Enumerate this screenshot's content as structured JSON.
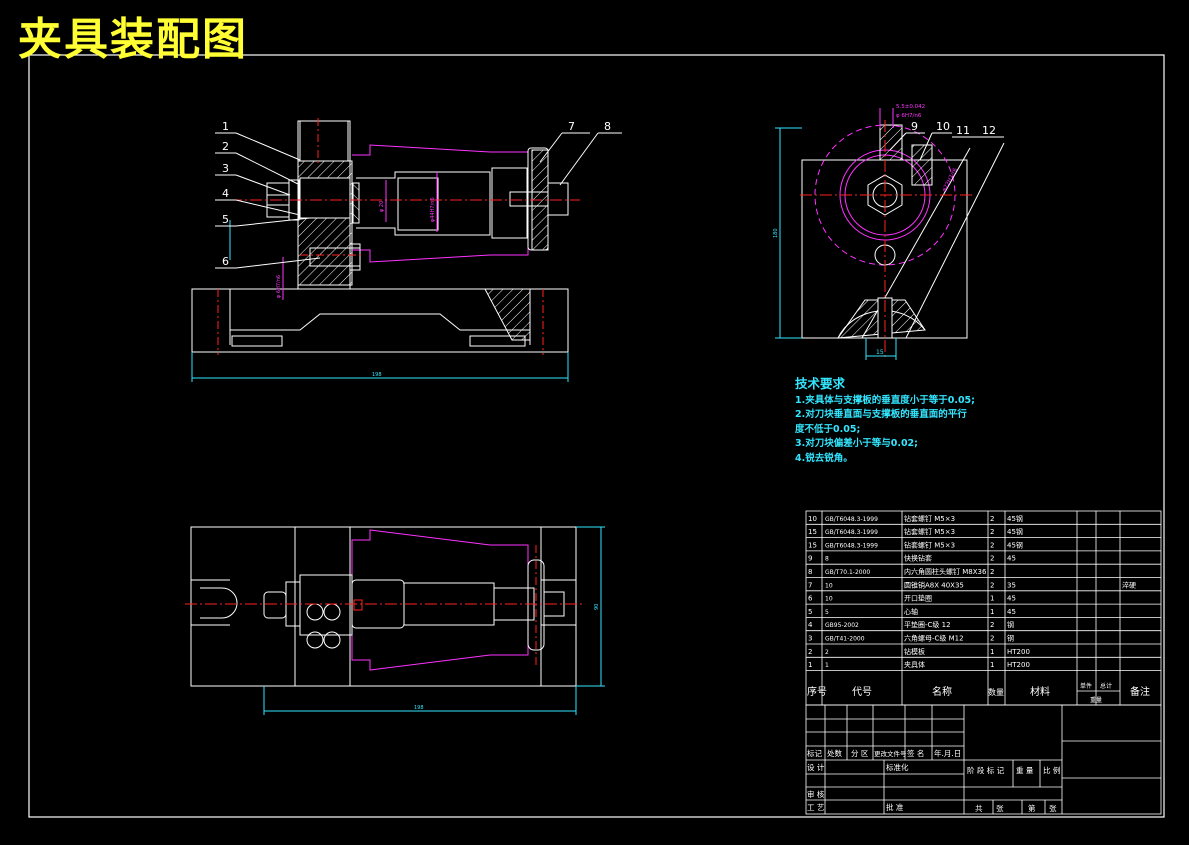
{
  "title": "夹具装配图",
  "colors": {
    "frame": "#ffffff",
    "part": "#ffffff",
    "magenta": "#ff33ff",
    "cyan": "#33e6ff",
    "red": "#ff2222",
    "yellow": "#ffff33",
    "hatch": "#ffffff"
  },
  "tech": {
    "heading": "技术要求",
    "lines": [
      "1.夹具体与支撑板的垂直度小于等于0.05;",
      "2.对刀块垂直面与支撑板的垂直面的平行",
      "度不低于0.05;",
      "3.对刀块偏差小于等与0.02;",
      "4.锐去锐角。"
    ]
  },
  "balloons_left": [
    "1",
    "2",
    "3",
    "4",
    "5",
    "6",
    "7",
    "8"
  ],
  "balloons_right": [
    "9",
    "10",
    "11",
    "12"
  ],
  "dims": {
    "front_width": "198",
    "top_width": "198",
    "top_height": "90",
    "side_height": "180",
    "side_bottom": "15",
    "side_top_a": "5.5±0.042",
    "side_top_b": "φ 6H7/n6",
    "side_diag": "φ22H7/r6",
    "bore_1": "φ 6H7/n6",
    "bore_2": "φ 20",
    "bore_3": "φ44H7/n6"
  },
  "bom": {
    "rows": [
      [
        "10",
        "GB/T6048.3-1999",
        "钻套螺钉 M5×3",
        "2",
        "45钢",
        ""
      ],
      [
        "15",
        "GB/T6048.3-1999",
        "钻套螺钉 M5×3",
        "2",
        "45钢",
        ""
      ],
      [
        "15",
        "GB/T6048.3-1999",
        "钻套螺钉 M5×3",
        "2",
        "45钢",
        ""
      ],
      [
        "9",
        "8",
        "快换钻套",
        "2",
        "45",
        ""
      ],
      [
        "8",
        "GB/T70.1-2000",
        "内六角圆柱头螺钉 M8X36",
        "2",
        "",
        ""
      ],
      [
        "7",
        "10",
        "圆锥销A8X 40X35",
        "2",
        "35",
        "淬硬"
      ],
      [
        "6",
        "10",
        "开口垫圈",
        "1",
        "45",
        ""
      ],
      [
        "5",
        "5",
        "心轴",
        "1",
        "45",
        ""
      ],
      [
        "4",
        "GB95-2002",
        "平垫圈-C级 12",
        "2",
        "钢",
        ""
      ],
      [
        "3",
        "GB/T41-2000",
        "六角螺母-C级 M12",
        "2",
        "钢",
        ""
      ],
      [
        "2",
        "2",
        "钻模板",
        "1",
        "HT200",
        ""
      ],
      [
        "1",
        "1",
        "夹具体",
        "1",
        "HT200",
        ""
      ]
    ],
    "header": {
      "seq": "序号",
      "code": "代号",
      "name": "名称",
      "qty": "数量",
      "material": "材料",
      "single": "单件",
      "total": "总计",
      "weight": "重量",
      "note": "备注"
    }
  },
  "titleblock": {
    "row1": [
      "标记",
      "处数",
      "分 区",
      "更改文件号",
      "签 名",
      "年.月.日"
    ],
    "design": "设 计",
    "standard": "标准化",
    "review": "审 核",
    "process": "工 艺",
    "approve": "批 准",
    "stage": [
      "阶 段 标 记",
      "重 量",
      "比 例"
    ],
    "sheets": [
      "共",
      "张",
      "第",
      "张"
    ]
  }
}
